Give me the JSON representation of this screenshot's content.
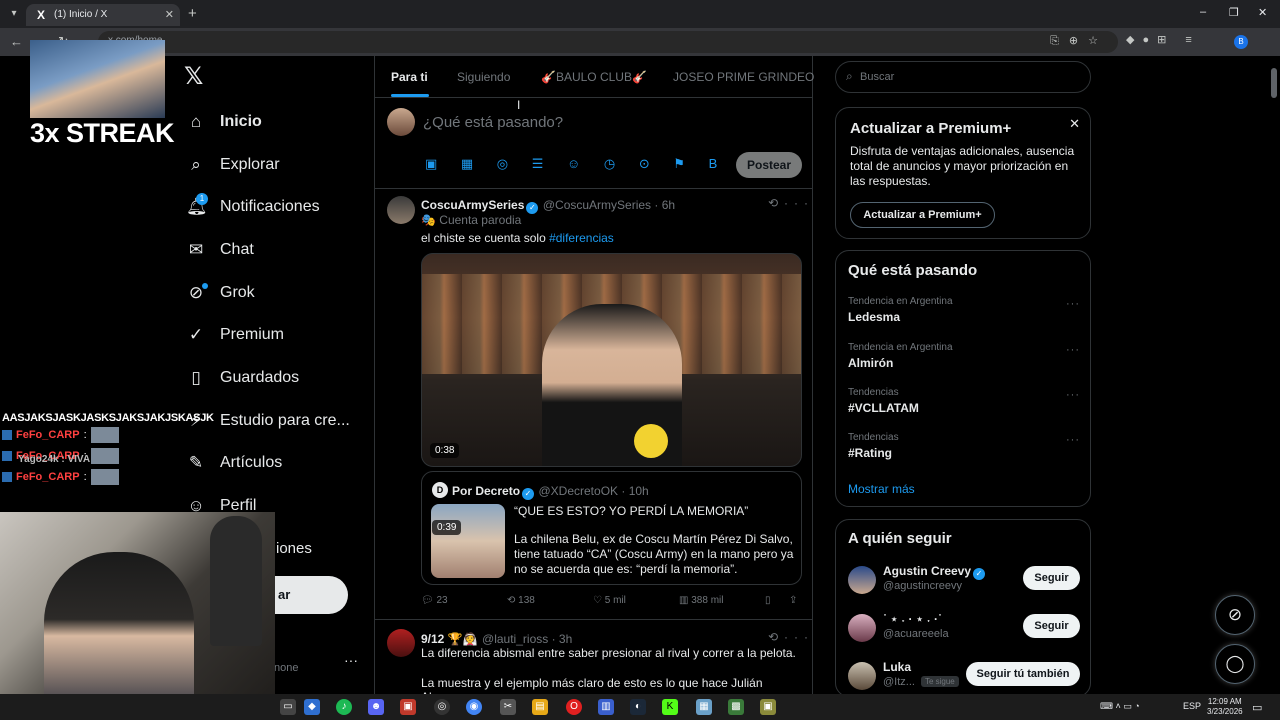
{
  "browser": {
    "tab_title": "(1) Inicio / X",
    "tab_favicon": "X",
    "tab_close": "✕",
    "new_tab": "+",
    "url": "x.com/home",
    "window_controls": [
      "–",
      "❐",
      "✕"
    ],
    "nav_icons": [
      "back-arrow-icon",
      "forward-arrow-icon",
      "reload-icon"
    ],
    "profile_initial": "B"
  },
  "overlay": {
    "streak_text": "3x STREAK",
    "chat_header": "AASJAKSJASKJASKSJAKSJAKJSKASJK",
    "chat_lines": [
      {
        "user": "FeFo_CARP"
      },
      {
        "user": "FeFo_CARP",
        "ghost": "Yago24k : VIVA"
      },
      {
        "user": "FeFo_CARP"
      }
    ],
    "chat_colon": ":"
  },
  "nav": {
    "items": [
      {
        "label": "Inicio",
        "icon": "⌂",
        "icon_name": "home-icon"
      },
      {
        "label": "Explorar",
        "icon": "⌕",
        "icon_name": "search-icon"
      },
      {
        "label": "Notificaciones",
        "icon": "🔔︎",
        "icon_name": "bell-icon",
        "badge": "1"
      },
      {
        "label": "Chat",
        "icon": "✉",
        "icon_name": "mail-icon"
      },
      {
        "label": "Grok",
        "icon": "⊘",
        "icon_name": "grok-icon"
      },
      {
        "label": "Premium",
        "icon": "✓",
        "icon_name": "premium-icon"
      },
      {
        "label": "Guardados",
        "icon": "▯",
        "icon_name": "bookmark-icon"
      },
      {
        "label": "Estudio para cre...",
        "icon": "⚡",
        "icon_name": "studio-icon"
      },
      {
        "label": "Artículos",
        "icon": "✎",
        "icon_name": "articles-icon"
      },
      {
        "label": "Perfil",
        "icon": "☺",
        "icon_name": "profile-icon"
      }
    ],
    "more_partial": "iones",
    "post_partial": "ar",
    "account_partial": "none",
    "account_dots": "···"
  },
  "feed": {
    "tabs": [
      "Para ti",
      "Siguiendo",
      "🎸BAULO CLUB🎸",
      "JOSEO PRIME GRINDEO"
    ],
    "compose_placeholder": "¿Qué está pasando?",
    "compose_tools": "▣ ▦ ◎ ☰ ☺ ◷ ⊙ ⚑ B I",
    "post_button": "Postear",
    "tweet1": {
      "name": "CoscuArmySeries",
      "handle": "@CoscuArmySeries · 6h",
      "parody": "🎭 Cuenta parodia",
      "text": "el chiste se cuenta solo ",
      "hashtag": "#diferencias",
      "video_time": "0:38",
      "quote": {
        "initial": "D",
        "name": "Por Decreto",
        "handle": "@XDecretoOK · 10h",
        "video_time": "0:39",
        "title": "“QUE ES ESTO? YO PERDÍ LA MEMORIA”",
        "body": "La chilena Belu, ex de Coscu Martín Pérez Di Salvo, tiene tatuado “CA” (Coscu Army) en la mano pero ya no se acuerda que es: “perdí la memoria”."
      },
      "replies": "23",
      "reposts": "138",
      "likes": "5 mil",
      "views": "388 mil"
    },
    "tweet2": {
      "name": "9/12 🏆👰",
      "handle": "@lauti_rioss · 3h",
      "text": "La diferencia abismal entre saber presionar al rival y correr a la pelota.",
      "text2": "La muestra y el ejemplo más claro de esto es lo que hace Julián Alvarez."
    }
  },
  "right": {
    "search_placeholder": "Buscar",
    "premium": {
      "title": "Actualizar a Premium+",
      "body": "Disfruta de ventajas adicionales, ausencia total de anuncios y mayor priorización en las respuestas.",
      "button": "Actualizar a Premium+",
      "close": "✕"
    },
    "trends_title": "Qué está pasando",
    "trends": [
      {
        "context": "Tendencia en Argentina",
        "name": "Ledesma"
      },
      {
        "context": "Tendencia en Argentina",
        "name": "Almirón"
      },
      {
        "context": "Tendencias",
        "name": "#VCLLATAM"
      },
      {
        "context": "Tendencias",
        "name": "#Rating"
      }
    ],
    "trend_more": "···",
    "show_more": "Mostrar más",
    "follow_title": "A quién seguir",
    "follow": [
      {
        "name": "Agustin Creevy",
        "handle": "@agustincreevy",
        "button": "Seguir",
        "verified": true
      },
      {
        "name": "˙ ⋆ ˖ · ⋆ ˖ ·˙",
        "handle": "@acuareeela",
        "button": "Seguir",
        "verified": false
      },
      {
        "name": "Luka",
        "handle": "@Itz...",
        "button": "Seguir tú también",
        "badge": "Te sigue",
        "verified": false
      }
    ]
  },
  "taskbar": {
    "lang": "ESP",
    "time": "12:09 AM",
    "date": "3/23/2026"
  },
  "colors": {
    "accent": "#1d9bf0",
    "background": "#000000",
    "text": "#e7e9ea",
    "muted": "#71767b",
    "border": "#2f3336"
  }
}
